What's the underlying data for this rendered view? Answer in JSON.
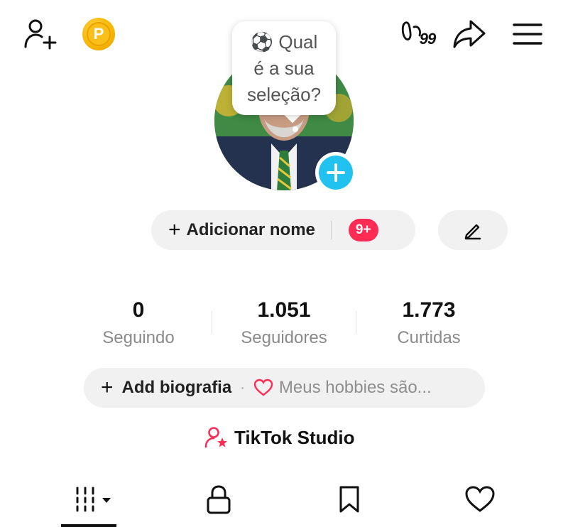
{
  "top_bar": {
    "add_friend_icon": "person-add-icon",
    "coin_icon": "coin-icon",
    "coin_letter": "P",
    "steps_count": "99",
    "share_icon": "share-arrow-icon",
    "menu_icon": "hamburger-menu-icon"
  },
  "avatar": {
    "bubble_emoji": "⚽",
    "bubble_text_line1": "Qual",
    "bubble_text_line2": "é a sua",
    "bubble_text_line3": "seleção?",
    "add_badge_icon": "plus-icon"
  },
  "profile": {
    "add_name_label": "Adicionar nome",
    "notification_badge": "9+",
    "edit_icon": "pencil-icon"
  },
  "stats": [
    {
      "value": "0",
      "label": "Seguindo"
    },
    {
      "value": "1.051",
      "label": "Seguidores"
    },
    {
      "value": "1.773",
      "label": "Curtidas"
    }
  ],
  "bio": {
    "add_label": "Add biografia",
    "separator": "·",
    "hint": "Meus hobbies são..."
  },
  "studio": {
    "label": "TikTok Studio"
  },
  "tabs": [
    {
      "icon": "grid-icon",
      "active": true
    },
    {
      "icon": "lock-icon",
      "active": false
    },
    {
      "icon": "bookmark-icon",
      "active": false
    },
    {
      "icon": "heart-icon",
      "active": false
    }
  ],
  "colors": {
    "accent_red": "#fe2c55",
    "accent_blue": "#21c2f0",
    "coin_gold": "#f7b500",
    "pill_bg": "#f1f1f2"
  }
}
